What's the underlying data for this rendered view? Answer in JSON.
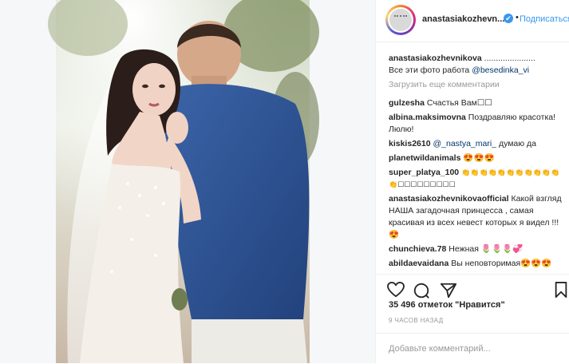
{
  "header": {
    "username": "anastasiakozhevn...",
    "follow_label": "Подписаться",
    "dot": "•",
    "verified_glyph": "✔"
  },
  "comments": {
    "caption_user": "anastasiakozhevnikova",
    "caption_dots": "......................",
    "caption_text": "Все эти фото работа",
    "caption_mention": "@besedinka_vi",
    "load_more": "Загрузить еще комментарии",
    "items": [
      {
        "user": "gulzesha",
        "text": "Счастья Вам☐☐"
      },
      {
        "user": "albina.maksimovna",
        "text": "Поздравляю красотка! Люлю!"
      },
      {
        "user": "kiskis2610",
        "mention": "@_nastya_mari_",
        "text": "думаю да"
      },
      {
        "user": "planetwildanimals",
        "text": "😍😍😍"
      },
      {
        "user": "super_platya_100",
        "text": "👏👏👏👏👏👏👏👏👏👏👏👏☐☐☐☐☐☐☐☐☐"
      },
      {
        "user": "anastasiakozhevnikovaofficial",
        "text": "Какой взгляд НАША загадочная принцесса , самая красивая из всех невест которых я видел !!!😍"
      },
      {
        "user": "chunchieva.78",
        "text": "Нежная 🌷🌷🌷💞"
      },
      {
        "user": "abildaevaidana",
        "text": "Вы неповторимая😍😍😍"
      }
    ]
  },
  "actions": {
    "like_icon": "heart-icon",
    "comment_icon": "comment-icon",
    "share_icon": "share-icon",
    "save_icon": "bookmark-icon",
    "likes_text": "35 496 отметок \"Нравится\"",
    "time_text": "9 ЧАСОВ НАЗАД"
  },
  "add_comment": {
    "placeholder": "Добавьте комментарий..."
  },
  "colors": {
    "link": "#3897f0",
    "mention": "#003569",
    "muted": "#999999",
    "jacket": "#2c4f8f"
  }
}
